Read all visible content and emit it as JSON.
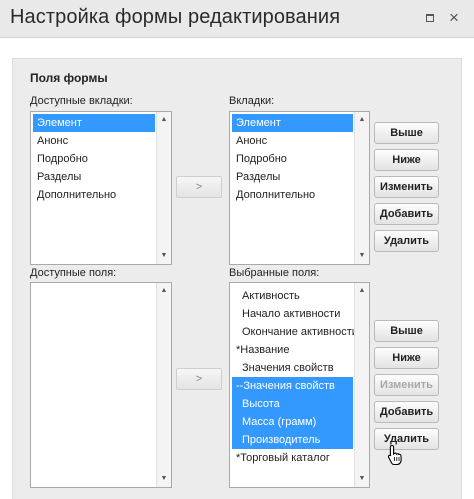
{
  "window": {
    "title": "Настройка формы редактирования"
  },
  "form": {
    "section_title": "Поля формы",
    "available_tabs": {
      "label": "Доступные вкладки:",
      "items": [
        {
          "text": "Элемент",
          "selected": true
        },
        {
          "text": "Анонс",
          "selected": false
        },
        {
          "text": "Подробно",
          "selected": false
        },
        {
          "text": "Разделы",
          "selected": false
        },
        {
          "text": "Дополнительно",
          "selected": false
        }
      ]
    },
    "tabs": {
      "label": "Вкладки:",
      "items": [
        {
          "text": "Элемент",
          "selected": true
        },
        {
          "text": "Анонс",
          "selected": false
        },
        {
          "text": "Подробно",
          "selected": false
        },
        {
          "text": "Разделы",
          "selected": false
        },
        {
          "text": "Дополнительно",
          "selected": false
        }
      ]
    },
    "available_fields": {
      "label": "Доступные поля:",
      "items": []
    },
    "selected_fields": {
      "label": "Выбранные поля:",
      "items": [
        {
          "text": "Активность",
          "selected": false,
          "indent": true
        },
        {
          "text": "Начало активности",
          "selected": false,
          "indent": true
        },
        {
          "text": "Окончание активности",
          "selected": false,
          "indent": true
        },
        {
          "text": "*Название",
          "selected": false,
          "indent": false
        },
        {
          "text": "Значения свойств",
          "selected": false,
          "indent": true
        },
        {
          "text": "--Значения свойств",
          "selected": true,
          "indent": false
        },
        {
          "text": "Высота",
          "selected": true,
          "indent": true
        },
        {
          "text": "Масса (грамм)",
          "selected": true,
          "indent": true
        },
        {
          "text": "Производитель",
          "selected": true,
          "indent": true
        },
        {
          "text": "*Торговый каталог",
          "selected": false,
          "indent": false
        }
      ]
    },
    "move_label": ">",
    "tab_buttons": {
      "up": "Выше",
      "down": "Ниже",
      "edit": "Изменить",
      "add": "Добавить",
      "delete": "Удалить"
    },
    "field_buttons": {
      "up": "Выше",
      "down": "Ниже",
      "edit": "Изменить",
      "add": "Добавить",
      "delete": "Удалить",
      "edit_disabled": true
    }
  },
  "colors": {
    "selection": "#3399ff",
    "titlebar": "#e9e9e9",
    "panel": "#ececec"
  }
}
